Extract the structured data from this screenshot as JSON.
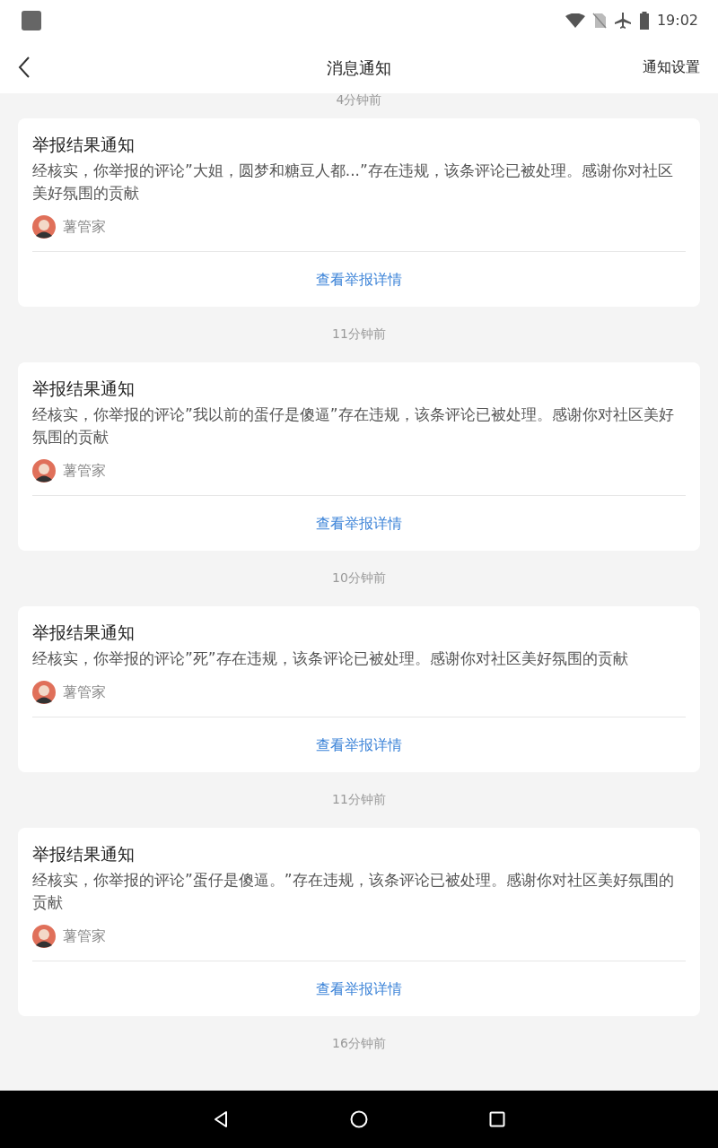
{
  "status_bar": {
    "time": "19:02"
  },
  "header": {
    "title": "消息通知",
    "action": "通知设置"
  },
  "feed": [
    {
      "kind": "notification",
      "time": "4分钟前",
      "title": "举报结果通知",
      "body": "经核实，你举报的评论”大姐，圆梦和糖豆人都...”存在违规，该条评论已被处理。感谢你对社区美好氛围的贡献",
      "author": "薯管家",
      "link": "查看举报详情"
    },
    {
      "kind": "notification",
      "time": "11分钟前",
      "title": "举报结果通知",
      "body": "经核实，你举报的评论”我以前的蛋仔是傻逼”存在违规，该条评论已被处理。感谢你对社区美好氛围的贡献",
      "author": "薯管家",
      "link": "查看举报详情"
    },
    {
      "kind": "notification",
      "time": "10分钟前",
      "title": "举报结果通知",
      "body": "经核实，你举报的评论”死”存在违规，该条评论已被处理。感谢你对社区美好氛围的贡献",
      "author": "薯管家",
      "link": "查看举报详情"
    },
    {
      "kind": "notification",
      "time": "11分钟前",
      "title": "举报结果通知",
      "body": "经核实，你举报的评论”蛋仔是傻逼。”存在违规，该条评论已被处理。感谢你对社区美好氛围的贡献",
      "author": "薯管家",
      "link": "查看举报详情"
    },
    {
      "kind": "timestamp",
      "time": "16分钟前"
    }
  ]
}
